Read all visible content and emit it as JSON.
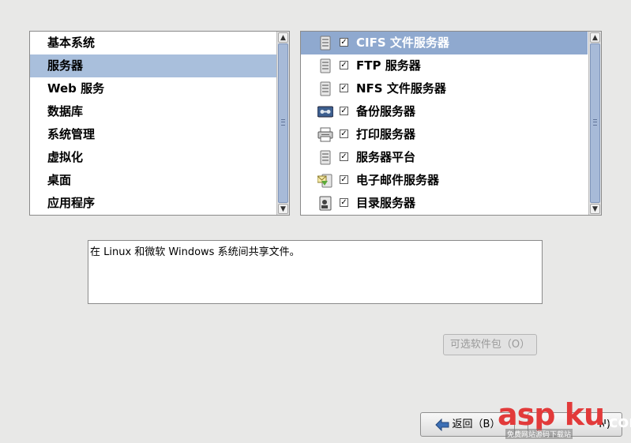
{
  "categories": {
    "items": [
      {
        "label": "基本系统"
      },
      {
        "label": "服务器"
      },
      {
        "label": "Web 服务"
      },
      {
        "label": "数据库"
      },
      {
        "label": "系统管理"
      },
      {
        "label": "虚拟化"
      },
      {
        "label": "桌面"
      },
      {
        "label": "应用程序"
      }
    ],
    "selected_index": 1
  },
  "groups": {
    "items": [
      {
        "label": "CIFS 文件服务器",
        "checked": true,
        "icon": "server-tower-icon"
      },
      {
        "label": "FTP 服务器",
        "checked": true,
        "icon": "server-tower-icon"
      },
      {
        "label": "NFS 文件服务器",
        "checked": true,
        "icon": "server-tower-icon"
      },
      {
        "label": "备份服务器",
        "checked": true,
        "icon": "backup-tape-icon"
      },
      {
        "label": "打印服务器",
        "checked": true,
        "icon": "printer-icon"
      },
      {
        "label": "服务器平台",
        "checked": true,
        "icon": "server-tower-icon"
      },
      {
        "label": "电子邮件服务器",
        "checked": true,
        "icon": "mail-server-icon"
      },
      {
        "label": "目录服务器",
        "checked": true,
        "icon": "directory-server-icon"
      }
    ],
    "selected_index": 0,
    "check_mark": "✓"
  },
  "description": "在 Linux 和微软 Windows 系统间共享文件。",
  "buttons": {
    "optional_packages": "可选软件包（O）",
    "back": "返回（B）",
    "next": "N)"
  },
  "scroll_arrows": {
    "up": "▲",
    "down": "▼"
  },
  "watermark": {
    "main": "asp ku",
    "tld": ".com",
    "sub": "免费网站源码下载站"
  },
  "colors": {
    "selection": "#a9bfdc",
    "group_selection": "#8fa9cf",
    "watermark": "#e23a3a"
  }
}
